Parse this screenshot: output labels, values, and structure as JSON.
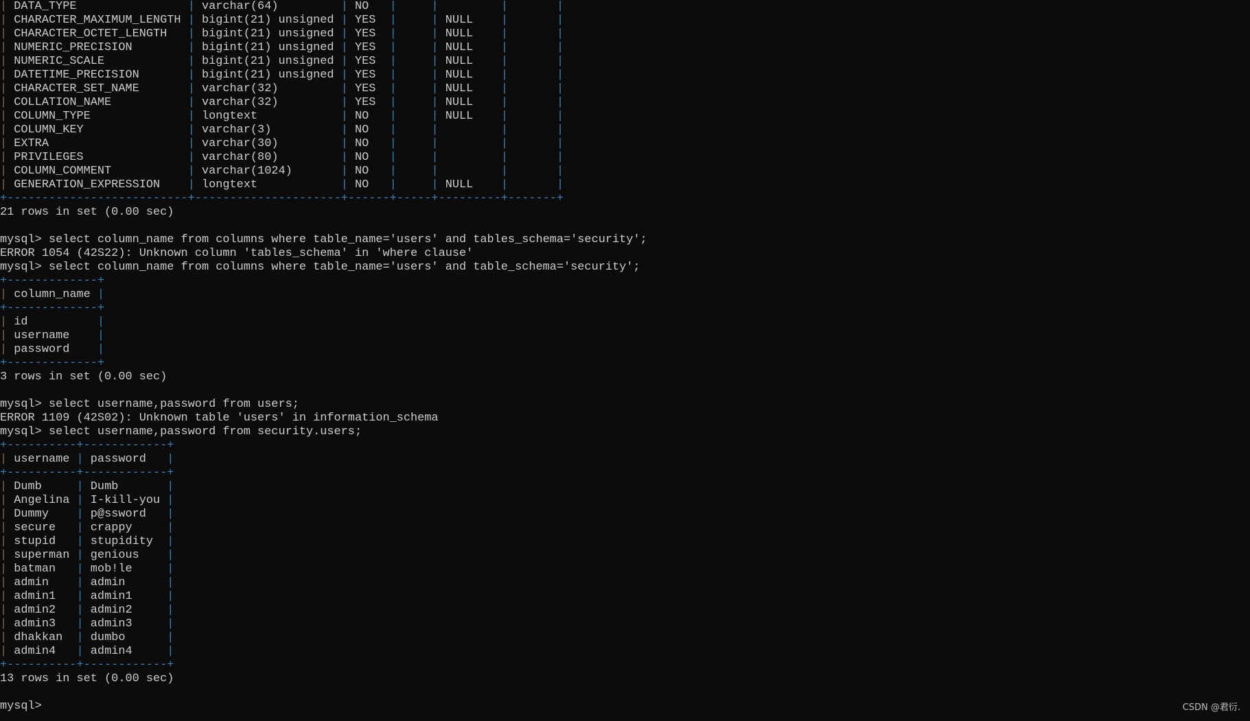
{
  "window": {
    "background": "#0c0c0c",
    "text_color": "#cccccc",
    "border_color": "#3a82b5"
  },
  "blocks": [
    {
      "type": "table",
      "show_header": false,
      "widths": [
        24,
        19,
        4,
        3,
        7,
        5
      ],
      "rows": [
        [
          "DATA_TYPE",
          "varchar(64)",
          "NO",
          "",
          "",
          ""
        ],
        [
          "CHARACTER_MAXIMUM_LENGTH",
          "bigint(21) unsigned",
          "YES",
          "",
          "NULL",
          ""
        ],
        [
          "CHARACTER_OCTET_LENGTH",
          "bigint(21) unsigned",
          "YES",
          "",
          "NULL",
          ""
        ],
        [
          "NUMERIC_PRECISION",
          "bigint(21) unsigned",
          "YES",
          "",
          "NULL",
          ""
        ],
        [
          "NUMERIC_SCALE",
          "bigint(21) unsigned",
          "YES",
          "",
          "NULL",
          ""
        ],
        [
          "DATETIME_PRECISION",
          "bigint(21) unsigned",
          "YES",
          "",
          "NULL",
          ""
        ],
        [
          "CHARACTER_SET_NAME",
          "varchar(32)",
          "YES",
          "",
          "NULL",
          ""
        ],
        [
          "COLLATION_NAME",
          "varchar(32)",
          "YES",
          "",
          "NULL",
          ""
        ],
        [
          "COLUMN_TYPE",
          "longtext",
          "NO",
          "",
          "NULL",
          ""
        ],
        [
          "COLUMN_KEY",
          "varchar(3)",
          "NO",
          "",
          "",
          ""
        ],
        [
          "EXTRA",
          "varchar(30)",
          "NO",
          "",
          "",
          ""
        ],
        [
          "PRIVILEGES",
          "varchar(80)",
          "NO",
          "",
          "",
          ""
        ],
        [
          "COLUMN_COMMENT",
          "varchar(1024)",
          "NO",
          "",
          "",
          ""
        ],
        [
          "GENERATION_EXPRESSION",
          "longtext",
          "NO",
          "",
          "NULL",
          ""
        ]
      ]
    },
    {
      "type": "text",
      "lines": [
        "21 rows in set (0.00 sec)",
        "",
        "mysql> select column_name from columns where table_name='users' and tables_schema='security';",
        "ERROR 1054 (42S22): Unknown column 'tables_schema' in 'where clause'",
        "mysql> select column_name from columns where table_name='users' and table_schema='security';"
      ]
    },
    {
      "type": "table",
      "show_header": true,
      "widths": [
        11
      ],
      "header": [
        "column_name"
      ],
      "rows": [
        [
          "id"
        ],
        [
          "username"
        ],
        [
          "password"
        ]
      ]
    },
    {
      "type": "text",
      "lines": [
        "3 rows in set (0.00 sec)",
        "",
        "mysql> select username,password from users;",
        "ERROR 1109 (42S02): Unknown table 'users' in information_schema",
        "mysql> select username,password from security.users;"
      ]
    },
    {
      "type": "table",
      "show_header": true,
      "widths": [
        8,
        10
      ],
      "header": [
        "username",
        "password"
      ],
      "rows": [
        [
          "Dumb",
          "Dumb"
        ],
        [
          "Angelina",
          "I-kill-you"
        ],
        [
          "Dummy",
          "p@ssword"
        ],
        [
          "secure",
          "crappy"
        ],
        [
          "stupid",
          "stupidity"
        ],
        [
          "superman",
          "genious"
        ],
        [
          "batman",
          "mob!le"
        ],
        [
          "admin",
          "admin"
        ],
        [
          "admin1",
          "admin1"
        ],
        [
          "admin2",
          "admin2"
        ],
        [
          "admin3",
          "admin3"
        ],
        [
          "dhakkan",
          "dumbo"
        ],
        [
          "admin4",
          "admin4"
        ]
      ]
    },
    {
      "type": "text",
      "lines": [
        "13 rows in set (0.00 sec)",
        "",
        "mysql> "
      ]
    }
  ],
  "watermark": "CSDN @君衍."
}
